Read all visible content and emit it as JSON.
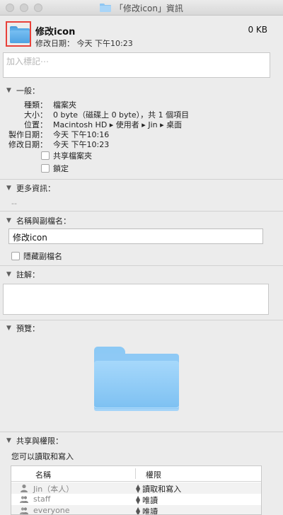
{
  "window": {
    "title": "「修改icon」資訊"
  },
  "header": {
    "name": "修改icon",
    "size": "0 KB",
    "modified_line": "修改日期： 今天 下午10:23"
  },
  "tags": {
    "placeholder": "加入標記⋯"
  },
  "general": {
    "title": "一般：",
    "rows": [
      {
        "label": "種類：",
        "value": "檔案夾"
      },
      {
        "label": "大小：",
        "value": "0 byte（磁碟上 0 byte），共 1 個項目"
      },
      {
        "label": "位置：",
        "value": "Macintosh HD ▸ 使用者 ▸ Jin ▸ 桌面"
      },
      {
        "label": "製作日期：",
        "value": "今天 下午10:16"
      },
      {
        "label": "修改日期：",
        "value": "今天 下午10:23"
      }
    ],
    "shared_folder": "共享檔案夾",
    "locked": "鎖定"
  },
  "more_info": {
    "title": "更多資訊：",
    "value": "--"
  },
  "name_ext": {
    "title": "名稱與副檔名：",
    "name_value": "修改icon",
    "hide_ext": "隱藏副檔名"
  },
  "comments": {
    "title": "註解："
  },
  "preview": {
    "title": "預覽："
  },
  "sharing": {
    "title": "共享與權限：",
    "note": "您可以讀取和寫入",
    "col_name": "名稱",
    "col_privilege": "權限",
    "rows": [
      {
        "name": "Jin（本人）",
        "privilege": "讀取和寫入",
        "icon": "single-user-icon"
      },
      {
        "name": "staff",
        "privilege": "唯讀",
        "icon": "group-icon"
      },
      {
        "name": "everyone",
        "privilege": "唯讀",
        "icon": "group-icon"
      }
    ]
  }
}
